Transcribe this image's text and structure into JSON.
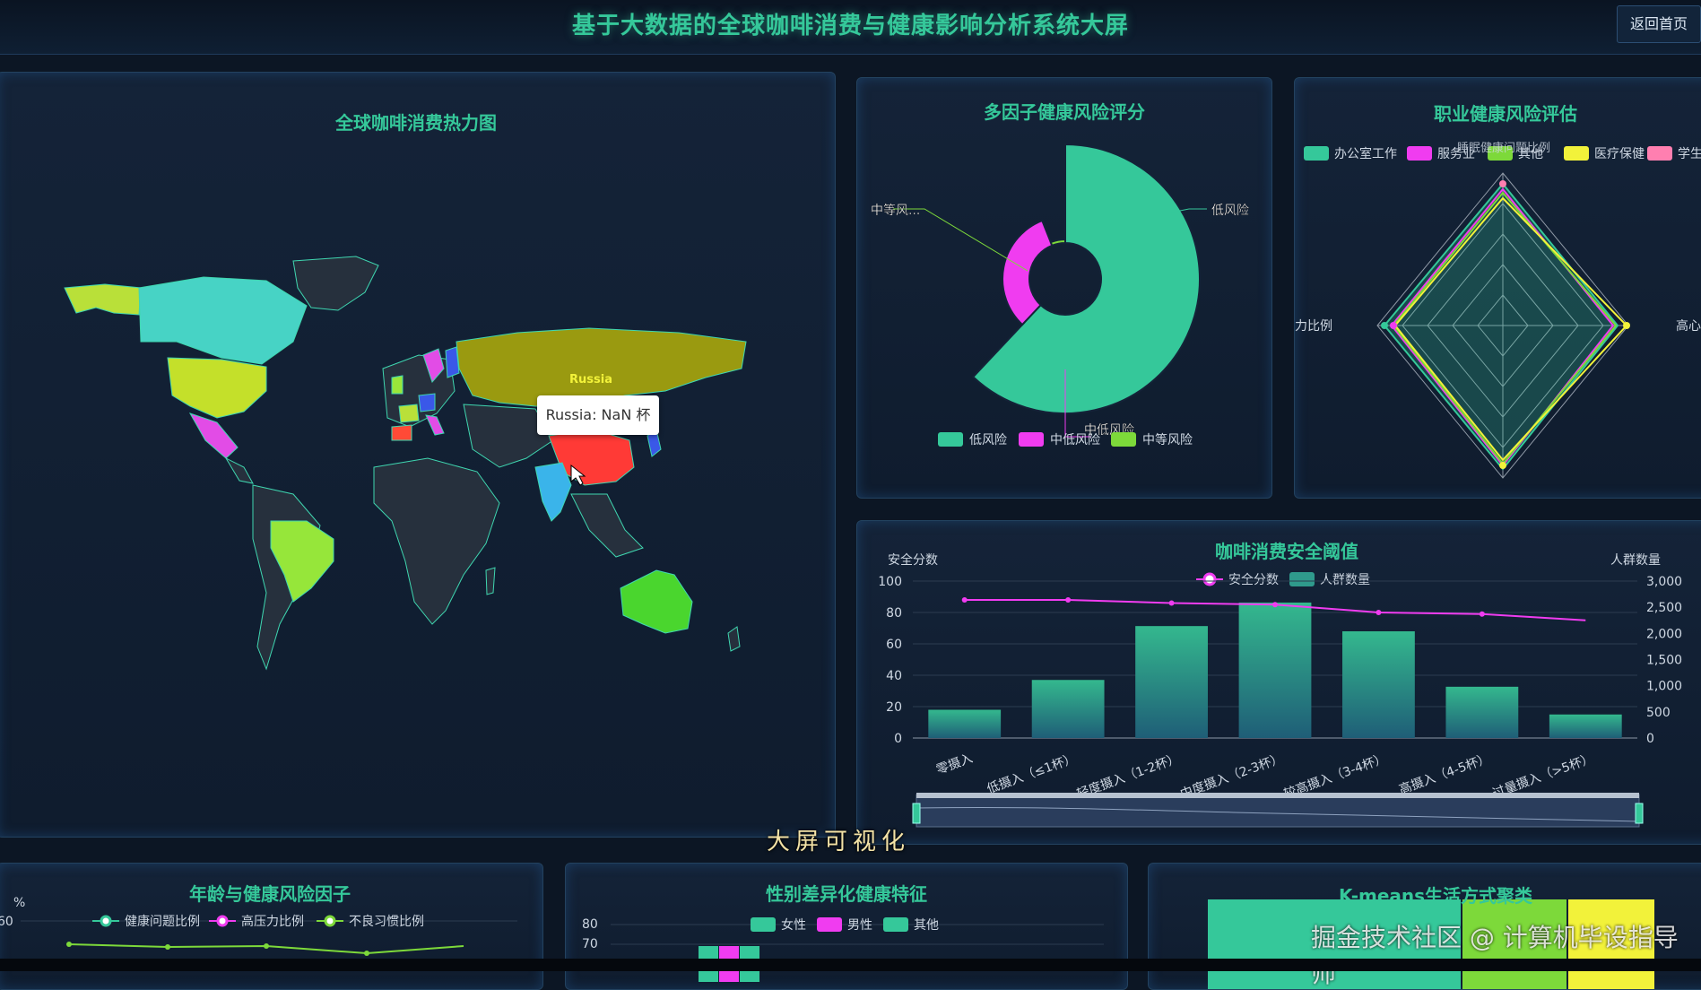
{
  "header": {
    "title": "基于大数据的全球咖啡消费与健康影响分析系统大屏",
    "home_button": "返回首页"
  },
  "colors": {
    "accent": "#35c89a",
    "magenta": "#f03cf0",
    "lime": "#7dd93a",
    "yellow": "#f2f23a",
    "pink": "#ff7fb0",
    "bg": "#0c1624"
  },
  "map_panel": {
    "title": "全球咖啡消费热力图",
    "label_russia": "Russia",
    "tooltip": "Russia: NaN 杯"
  },
  "risk_panel": {
    "title": "多因子健康风险评分",
    "labels": [
      "中等风...",
      "低风险",
      "中低风险"
    ],
    "legend": [
      "低风险",
      "中低风险",
      "中等风险"
    ]
  },
  "occupation_panel": {
    "title": "职业健康风险评估",
    "legend": [
      "办公室工作",
      "服务业",
      "其他",
      "医疗保健",
      "学生"
    ],
    "axis_top": "睡眠健康问题比例",
    "axis_left": "力比例",
    "axis_right": "高心"
  },
  "threshold_panel": {
    "title": "咖啡消费安全阈值",
    "left_axis_title": "安全分数",
    "right_axis_title": "人群数量",
    "legend": [
      "安全分数",
      "人群数量"
    ],
    "left_ticks": [
      "100",
      "80",
      "60",
      "40",
      "20",
      "0"
    ],
    "right_ticks": [
      "3,000",
      "2,500",
      "2,000",
      "1,500",
      "1,000",
      "500",
      "0"
    ],
    "categories": [
      "零摄入",
      "低摄入（≤1杯）",
      "轻度摄入（1-2杯）",
      "中度摄入（2-3杯）",
      "较高摄入（3-4杯）",
      "高摄入（4-5杯）",
      "过量摄入（>5杯）"
    ]
  },
  "chart_data": [
    {
      "type": "bar",
      "title": "咖啡消费安全阈值",
      "categories": [
        "零摄入",
        "低摄入（≤1杯）",
        "轻度摄入（1-2杯）",
        "中度摄入（2-3杯）",
        "较高摄入（3-4杯）",
        "高摄入（4-5杯）",
        "过量摄入（>5杯）"
      ],
      "series": [
        {
          "name": "人群数量",
          "kind": "bar",
          "axis": "right",
          "values": [
            540,
            1110,
            2140,
            2590,
            2040,
            980,
            450
          ]
        },
        {
          "name": "安全分数",
          "kind": "line",
          "axis": "left",
          "values": [
            88,
            88,
            86,
            85,
            80,
            79,
            75
          ]
        }
      ],
      "ylim_left": [
        0,
        100
      ],
      "ylim_right": [
        0,
        3000
      ],
      "ylabel": "安全分数",
      "ylabel_right": "人群数量"
    },
    {
      "type": "pie",
      "title": "多因子健康风险评分",
      "categories": [
        "低风险",
        "中低风险",
        "中等风险"
      ],
      "values": [
        62,
        32,
        6
      ]
    }
  ],
  "age_panel": {
    "title": "年龄与健康风险因子",
    "unit": "%",
    "tick": "60",
    "legend": [
      "健康问题比例",
      "高压力比例",
      "不良习惯比例"
    ]
  },
  "gender_panel": {
    "title": "性别差异化健康特征",
    "ticks": [
      "80",
      "70"
    ],
    "legend": [
      "女性",
      "男性",
      "其他"
    ]
  },
  "kmeans_panel": {
    "title": "K-means生活方式聚类"
  },
  "overlay": {
    "watermark": "大屏可视化",
    "credit": "掘金技术社区 @ 计算机毕设指导师"
  }
}
